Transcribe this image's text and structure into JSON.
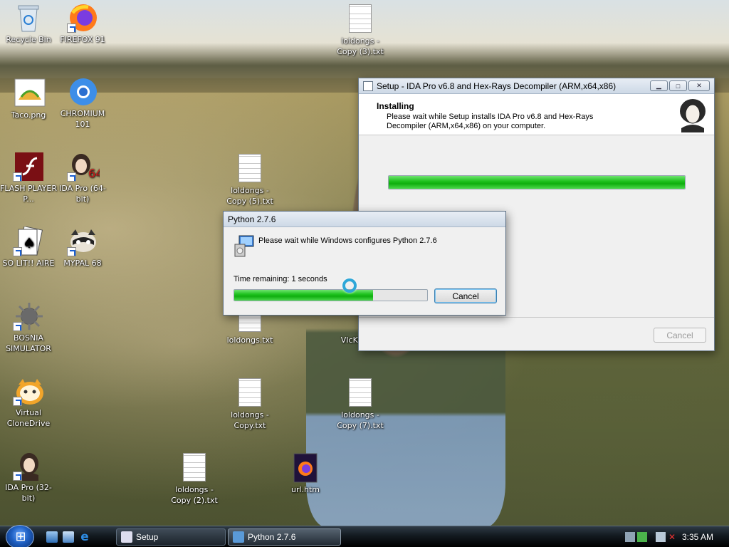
{
  "desktop": {
    "icons": [
      {
        "label": "Recycle Bin",
        "icon": "recycle-bin-icon"
      },
      {
        "label": "FIREFOX 91",
        "icon": "firefox-icon"
      },
      {
        "label": "loldongs - Copy (3).txt",
        "icon": "text-file-icon"
      },
      {
        "label": "Taco.png",
        "icon": "taco-image-icon"
      },
      {
        "label": "CHROMIUM 101",
        "icon": "chromium-icon"
      },
      {
        "label": "FLASH PLAYER P...",
        "icon": "flash-player-icon"
      },
      {
        "label": "IDA Pro (64-bit)",
        "icon": "ida-pro-icon"
      },
      {
        "label": "loldongs - Copy (5).txt",
        "icon": "text-file-icon"
      },
      {
        "label": "SO LIT!! AIRE",
        "icon": "solitaire-icon"
      },
      {
        "label": "MYPAL 68",
        "icon": "mypal-icon"
      },
      {
        "label": "BOSNIA SIMULATOR",
        "icon": "bosnia-simulator-icon"
      },
      {
        "label": "loldongs.txt",
        "icon": "text-file-icon"
      },
      {
        "label": "VIcKu",
        "icon": "app-icon"
      },
      {
        "label": "Virtual CloneDrive",
        "icon": "virtual-clonedrive-icon"
      },
      {
        "label": "loldongs - Copy.txt",
        "icon": "text-file-icon"
      },
      {
        "label": "loldongs - Copy (7).txt",
        "icon": "text-file-icon"
      },
      {
        "label": "IDA Pro (32-bit)",
        "icon": "ida-pro-icon"
      },
      {
        "label": "loldongs - Copy (2).txt",
        "icon": "text-file-icon"
      },
      {
        "label": "url.htm",
        "icon": "firefox-html-icon"
      }
    ]
  },
  "setup_window": {
    "title": "Setup - IDA Pro v6.8 and Hex-Rays Decompiler (ARM,x64,x86)",
    "heading": "Installing",
    "description": "Please wait while Setup installs IDA Pro v6.8 and Hex-Rays Decompiler (ARM,x64,x86) on your computer.",
    "progress": 1.0,
    "cancel_label": "Cancel"
  },
  "python_window": {
    "title": "Python 2.7.6",
    "message": "Please wait while Windows configures Python 2.7.6",
    "time_remaining": "Time remaining: 1 seconds",
    "progress": 0.72,
    "cancel_label": "Cancel"
  },
  "taskbar": {
    "tasks": [
      {
        "label": "Setup"
      },
      {
        "label": "Python 2.7.6"
      }
    ],
    "clock": "3:35 AM"
  },
  "colors": {
    "progress_green": "#21c321",
    "taskbar": "#131a20"
  }
}
